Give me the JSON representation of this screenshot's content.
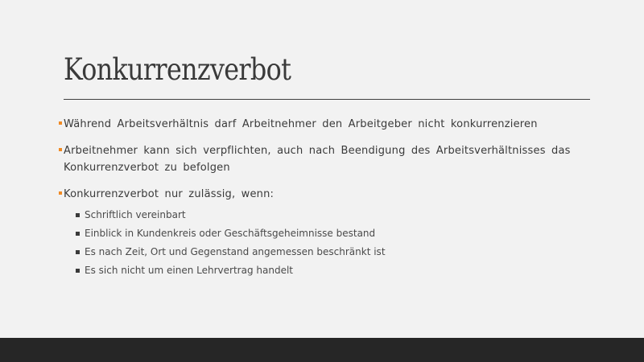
{
  "slide": {
    "title": "Konkurrenzverbot",
    "bullets": [
      {
        "text": "Während Arbeitsverhältnis darf Arbeitnehmer den Arbeitgeber nicht konkurrenzieren"
      },
      {
        "text": "Arbeitnehmer kann sich verpflichten, auch nach Beendigung des Arbeitsverhältnisses das Konkurrenzverbot zu befolgen"
      },
      {
        "text": "Konkurrenzverbot nur zulässig, wenn:",
        "sub": [
          "Schriftlich vereinbart",
          "Einblick in Kundenkreis oder Geschäftsgeheimnisse bestand",
          "Es nach Zeit, Ort und Gegenstand angemessen beschränkt ist",
          "Es sich nicht um einen Lehrvertrag handelt"
        ]
      }
    ]
  },
  "colors": {
    "accent": "#f08a24",
    "background": "#f2f2f2",
    "footer": "#262626",
    "text": "#3a3a3a"
  }
}
